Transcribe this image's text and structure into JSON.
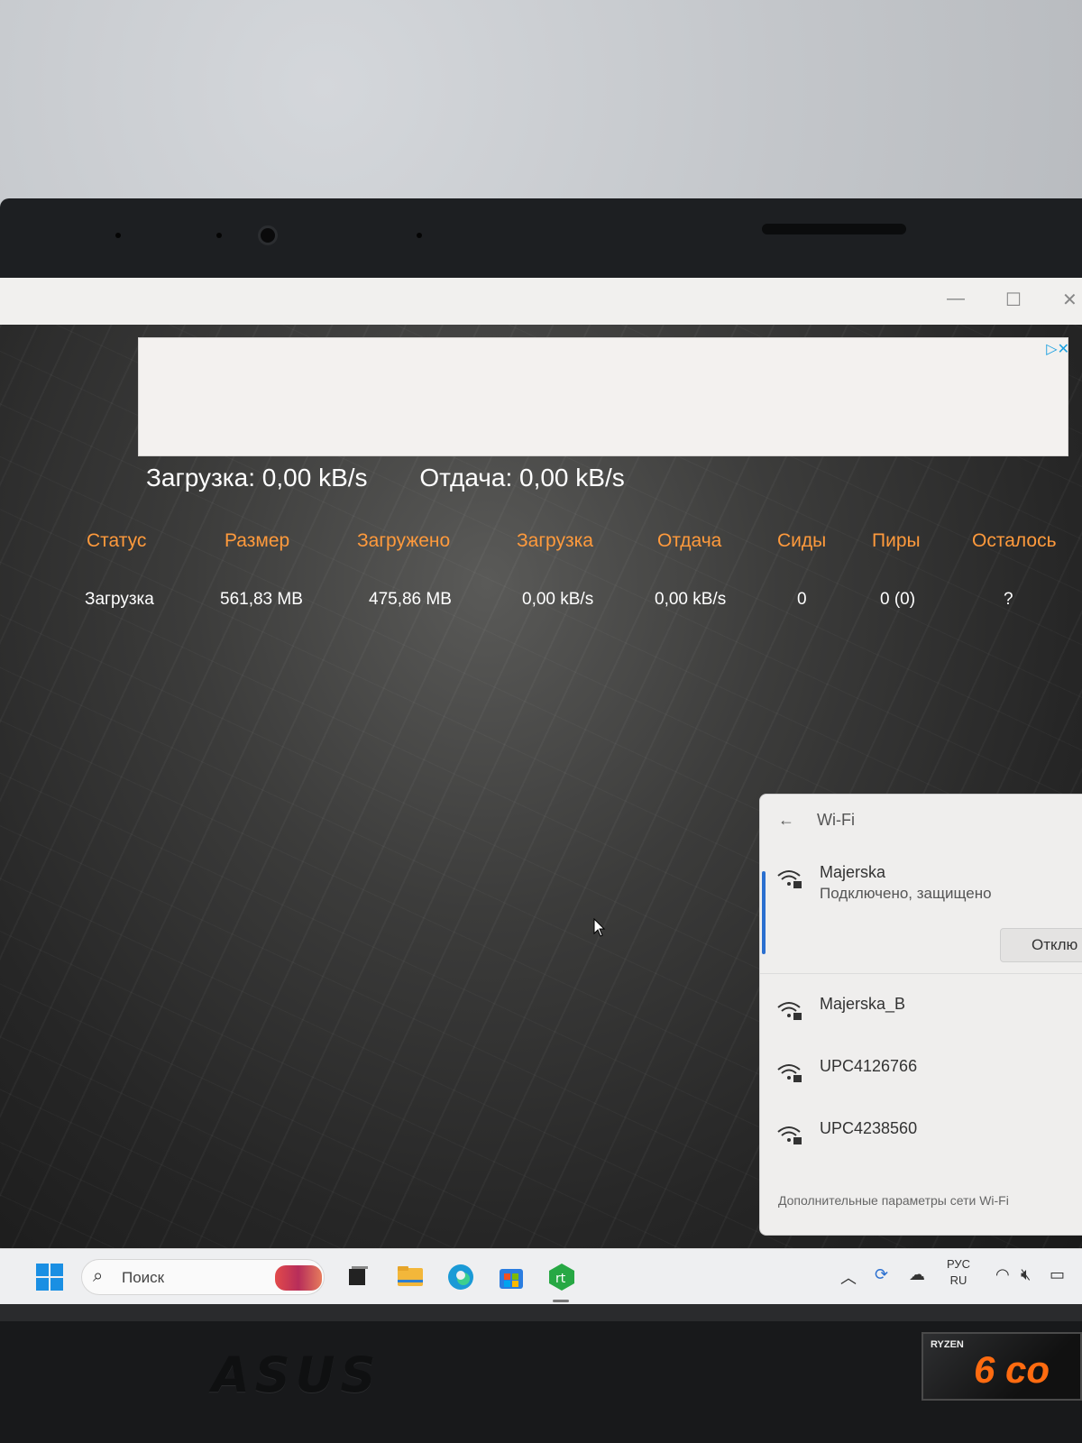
{
  "speeds": {
    "download": "Загрузка: 0,00 kB/s",
    "upload": "Отдача: 0,00 kB/s"
  },
  "table": {
    "headers": [
      "Статус",
      "Размер",
      "Загружено",
      "Загрузка",
      "Отдача",
      "Сиды",
      "Пиры",
      "Осталось"
    ],
    "rows": [
      [
        "Загрузка",
        "561,83 MB",
        "475,86 MB",
        "0,00 kB/s",
        "0,00 kB/s",
        "0",
        "0 (0)",
        "?"
      ]
    ]
  },
  "wifi": {
    "title": "Wi-Fi",
    "connected": {
      "name": "Majerska",
      "status": "Подключено, защищено",
      "disconnect_label": "Отклю"
    },
    "networks": [
      "Majerska_B",
      "UPC4126766",
      "UPC4238560"
    ],
    "more_settings": "Дополнительные параметры сети Wi-Fi"
  },
  "taskbar": {
    "search_placeholder": "Поиск",
    "lang_line1": "РУС",
    "lang_line2": "RU"
  },
  "hardware": {
    "brand": "ASUS",
    "sticker_line1": "RYZEN",
    "sticker_line2": "6 co"
  },
  "colors": {
    "header_text": "#ff9a3c",
    "accent": "#2a6fd0"
  }
}
